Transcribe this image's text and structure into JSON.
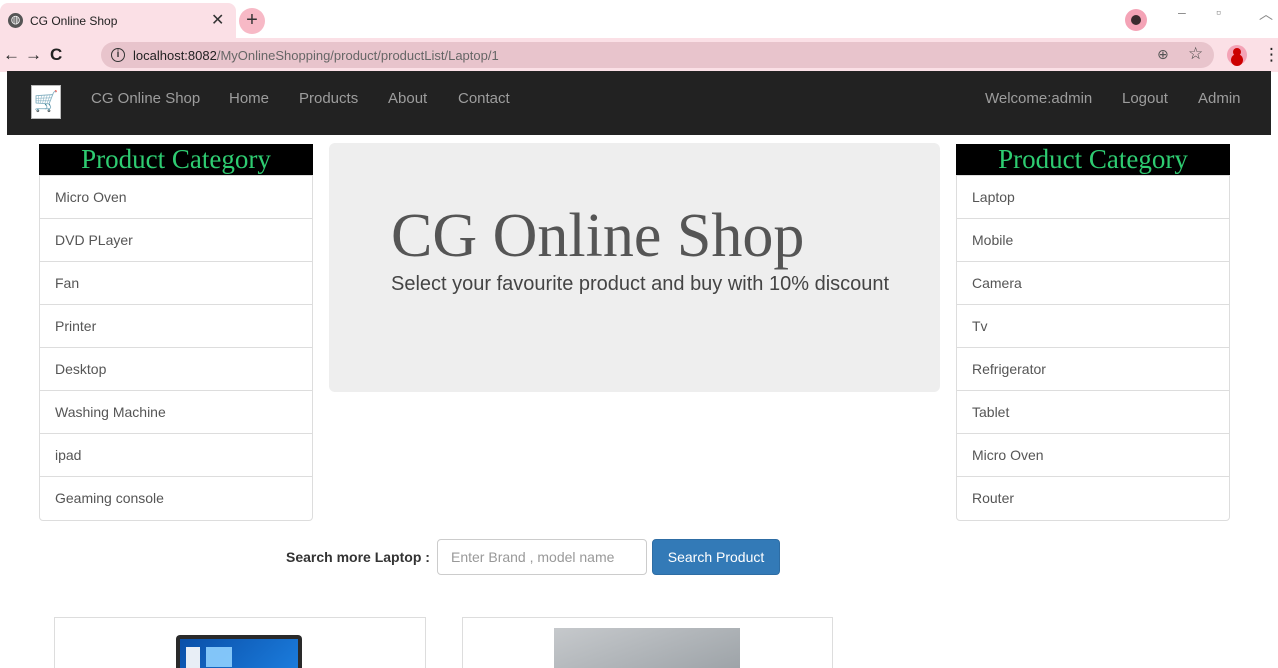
{
  "browser": {
    "tab_title": "CG Online Shop",
    "url_host": "localhost:8082",
    "url_path": "/MyOnlineShopping/product/productList/Laptop/1",
    "icons": [
      "globe-icon",
      "close-icon",
      "plus-icon",
      "back-icon",
      "forward-icon",
      "reload-icon",
      "info-icon",
      "zoom-icon",
      "star-icon",
      "account-icon",
      "menu-icon"
    ]
  },
  "navbar": {
    "brand": "CG Online Shop",
    "links": [
      "Home",
      "Products",
      "About",
      "Contact"
    ],
    "welcome": "Welcome:admin",
    "logout": "Logout",
    "admin": "Admin",
    "background": "#222222",
    "link_color": "#9d9d9d"
  },
  "left_categories": {
    "header": "Product Category",
    "items": [
      "Micro Oven",
      "DVD PLayer",
      "Fan",
      "Printer",
      "Desktop",
      "Washing Machine",
      "ipad",
      "Geaming console"
    ]
  },
  "right_categories": {
    "header": "Product Category",
    "items": [
      "Laptop",
      "Mobile",
      "Camera",
      "Tv",
      "Refrigerator",
      "Tablet",
      "Micro Oven",
      "Router"
    ]
  },
  "jumbotron": {
    "title": "CG Online Shop",
    "subtitle": "Select your favourite product and buy with 10% discount"
  },
  "search": {
    "label": "Search more Laptop :",
    "placeholder": "Enter Brand , model name",
    "button": "Search Product",
    "button_color": "#337ab7"
  },
  "colors": {
    "category_header_text": "#2ecc71",
    "category_header_bg": "#000000"
  }
}
